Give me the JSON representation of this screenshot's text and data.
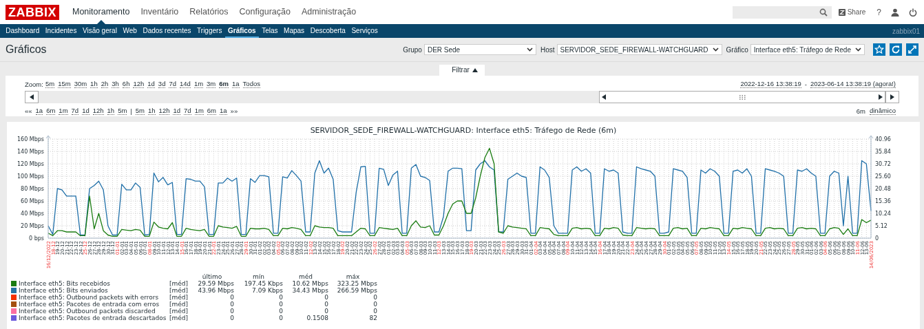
{
  "header": {
    "logo": "ZABBIX",
    "menu": [
      {
        "label": "Monitoramento",
        "selected": true
      },
      {
        "label": "Inventário",
        "selected": false
      },
      {
        "label": "Relatórios",
        "selected": false
      },
      {
        "label": "Configuração",
        "selected": false
      },
      {
        "label": "Administração",
        "selected": false
      }
    ],
    "share": "Share",
    "help": "?"
  },
  "submenu": {
    "items": [
      {
        "label": "Dashboard",
        "selected": false
      },
      {
        "label": "Incidentes",
        "selected": false
      },
      {
        "label": "Visão geral",
        "selected": false
      },
      {
        "label": "Web",
        "selected": false
      },
      {
        "label": "Dados recentes",
        "selected": false
      },
      {
        "label": "Triggers",
        "selected": false
      },
      {
        "label": "Gráficos",
        "selected": true
      },
      {
        "label": "Telas",
        "selected": false
      },
      {
        "label": "Mapas",
        "selected": false
      },
      {
        "label": "Descoberta",
        "selected": false
      },
      {
        "label": "Serviços",
        "selected": false
      }
    ],
    "server": "zabbix01"
  },
  "page": {
    "title": "Gráficos",
    "filters": [
      {
        "label": "Grupo",
        "value": "DER Sede"
      },
      {
        "label": "Host",
        "value": "SERVIDOR_SEDE_FIREWALL-WATCHGUARD"
      },
      {
        "label": "Gráfico",
        "value": "Interface eth5: Tráfego de Rede"
      }
    ]
  },
  "filter_tab": {
    "label": "Filtrar",
    "expanded": true
  },
  "time": {
    "zoom_label": "Zoom:",
    "zoom": [
      {
        "label": "5m",
        "selected": false
      },
      {
        "label": "15m",
        "selected": false
      },
      {
        "label": "30m",
        "selected": false
      },
      {
        "label": "1h",
        "selected": false
      },
      {
        "label": "2h",
        "selected": false
      },
      {
        "label": "3h",
        "selected": false
      },
      {
        "label": "6h",
        "selected": false
      },
      {
        "label": "12h",
        "selected": false
      },
      {
        "label": "1d",
        "selected": false
      },
      {
        "label": "3d",
        "selected": false
      },
      {
        "label": "7d",
        "selected": false
      },
      {
        "label": "14d",
        "selected": false
      },
      {
        "label": "1m",
        "selected": false
      },
      {
        "label": "3m",
        "selected": false
      },
      {
        "label": "6m",
        "selected": true
      },
      {
        "label": "1a",
        "selected": false
      },
      {
        "label": "Todos",
        "selected": false
      }
    ],
    "back_label": "««",
    "back": [
      "1a",
      "6m",
      "1m",
      "7d",
      "1d",
      "12h",
      "1h",
      "5m"
    ],
    "separator": "|",
    "forward": [
      "5m",
      "1h",
      "12h",
      "1d",
      "7d",
      "1m",
      "6m",
      "1a"
    ],
    "forward_label": "»»",
    "range_from": "2022-12-16 13:38:19",
    "range_separator": "-",
    "range_to": "2023-06-14 13:38:19 (agora!)",
    "period": "6m",
    "mode": "dinâmico"
  },
  "graph": {
    "title": "SERVIDOR_SEDE_FIREWALL-WATCHGUARD: Interface eth5: Tráfego de Rede (6m)",
    "chart_data": {
      "type": "line",
      "grid": true,
      "ylim": [
        0,
        160
      ],
      "y2lim": [
        0,
        40.96
      ],
      "yticks": [
        {
          "value": 0,
          "label": "0 bps"
        },
        {
          "value": 20,
          "label": "20 Mbps"
        },
        {
          "value": 40,
          "label": "40 Mbps"
        },
        {
          "value": 60,
          "label": "60 Mbps"
        },
        {
          "value": 80,
          "label": "80 Mbps"
        },
        {
          "value": 100,
          "label": "100 Mbps"
        },
        {
          "value": 120,
          "label": "120 Mbps"
        },
        {
          "value": 140,
          "label": "140 Mbps"
        },
        {
          "value": 160,
          "label": "160 Mbps"
        }
      ],
      "y2ticks": [
        {
          "value": 0,
          "label": "0"
        },
        {
          "value": 5.12,
          "label": "5.12"
        },
        {
          "value": 10.24,
          "label": "10.24"
        },
        {
          "value": 15.36,
          "label": "15.36"
        },
        {
          "value": 20.48,
          "label": "20.48"
        },
        {
          "value": 25.6,
          "label": "25.60"
        },
        {
          "value": 30.72,
          "label": "30.72"
        },
        {
          "value": 35.84,
          "label": "35.84"
        },
        {
          "value": 40.96,
          "label": "40.96"
        }
      ],
      "categories": [
        "16/12/2022",
        "18-12",
        "19-12",
        "20-12",
        "21-12",
        "22-12",
        "23-12",
        "24-12",
        "25-12",
        "26-12",
        "27-12",
        "28-12",
        "29-12",
        "30-12",
        "31-12",
        "01-01",
        "02-01",
        "03-01",
        "04-01",
        "05-01",
        "06-01",
        "07-01",
        "08-01",
        "09-01",
        "10-01",
        "11-01",
        "12-01",
        "13-01",
        "14-01",
        "15-01",
        "16-01",
        "17-01",
        "18-01",
        "19-01",
        "20-01",
        "21-01",
        "22-01",
        "23-01",
        "24-01",
        "25-01",
        "26-01",
        "27-01",
        "28-01",
        "29-01",
        "30-01",
        "31-01",
        "01-02",
        "02-02",
        "03-02",
        "04-02",
        "05-02",
        "06-02",
        "07-02",
        "08-02",
        "09-02",
        "10-02",
        "11-02",
        "12-02",
        "13-02",
        "14-02",
        "15-02",
        "16-02",
        "17-02",
        "18-02",
        "19-02",
        "20-02",
        "21-02",
        "22-02",
        "23-02",
        "24-02",
        "25-02",
        "26-02",
        "27-02",
        "28-02",
        "01-03",
        "02-03",
        "03-03",
        "04-03",
        "05-03",
        "06-03",
        "07-03",
        "08-03",
        "09-03",
        "10-03",
        "11-03",
        "12-03",
        "13-03",
        "14-03",
        "15-03",
        "16-03",
        "17-03",
        "18-03",
        "19-03",
        "20-03",
        "21-03",
        "22-03",
        "23-03",
        "24-03",
        "25-03",
        "26-03",
        "27-03",
        "28-03",
        "29-03",
        "30-03",
        "31-03",
        "01-04",
        "02-04",
        "03-04",
        "04-04",
        "05-04",
        "06-04",
        "07-04",
        "08-04",
        "09-04",
        "10-04",
        "11-04",
        "12-04",
        "13-04",
        "14-04",
        "15-04",
        "16-04",
        "17-04",
        "18-04",
        "19-04",
        "20-04",
        "21-04",
        "22-04",
        "23-04",
        "24-04",
        "25-04",
        "26-04",
        "27-04",
        "28-04",
        "29-04",
        "30-04",
        "01-05",
        "02-05",
        "03-05",
        "04-05",
        "05-05",
        "06-05",
        "07-05",
        "08-05",
        "09-05",
        "10-05",
        "11-05",
        "12-05",
        "13-05",
        "14-05",
        "15-05",
        "16-05",
        "17-05",
        "18-05",
        "19-05",
        "20-05",
        "21-05",
        "22-05",
        "23-05",
        "24-05",
        "25-05",
        "26-05",
        "27-05",
        "28-05",
        "29-05",
        "30-05",
        "31-05",
        "01-06",
        "02-06",
        "03-06",
        "04-06",
        "05-06",
        "06-06",
        "07-06",
        "08-06",
        "09-06",
        "10-06",
        "11-06",
        "12-06",
        "13-06",
        "14/06/2023"
      ],
      "series": [
        {
          "color": "#1f6fa8",
          "values": [
            20,
            6,
            80,
            78,
            68,
            68,
            68,
            5,
            5,
            80,
            85,
            92,
            78,
            20,
            5,
            5,
            87,
            78,
            78,
            89,
            82,
            5,
            6,
            105,
            91,
            98,
            86,
            90,
            6,
            6,
            96,
            95,
            92,
            92,
            83,
            6,
            6,
            89,
            89,
            97,
            92,
            97,
            6,
            6,
            96,
            90,
            101,
            101,
            99,
            8,
            8,
            99,
            97,
            109,
            101,
            92,
            10,
            10,
            105,
            125,
            105,
            113,
            95,
            12,
            10,
            10,
            10,
            74,
            115,
            116,
            8,
            8,
            113,
            111,
            85,
            102,
            108,
            8,
            8,
            113,
            119,
            100,
            98,
            93,
            10,
            10,
            35,
            108,
            113,
            113,
            112,
            12,
            12,
            110,
            120,
            125,
            115,
            110,
            10,
            10,
            95,
            100,
            105,
            100,
            98,
            8,
            8,
            115,
            110,
            98,
            20,
            8,
            8,
            8,
            110,
            115,
            108,
            112,
            105,
            8,
            8,
            112,
            108,
            110,
            105,
            10,
            8,
            8,
            115,
            112,
            110,
            108,
            100,
            8,
            8,
            10,
            112,
            110,
            108,
            98,
            8,
            8,
            110,
            105,
            112,
            108,
            100,
            8,
            8,
            108,
            110,
            105,
            112,
            100,
            8,
            8,
            112,
            110,
            108,
            105,
            100,
            8,
            8,
            110,
            108,
            112,
            105,
            100,
            8,
            8,
            100,
            108,
            105,
            20,
            100,
            8,
            8,
            125,
            120,
            44
          ]
        },
        {
          "color": "#1a7c11",
          "values": [
            8,
            4,
            12,
            12,
            10,
            10,
            10,
            4,
            4,
            68,
            15,
            40,
            12,
            5,
            3,
            3,
            14,
            13,
            12,
            14,
            13,
            3,
            3,
            26,
            18,
            16,
            15,
            25,
            3,
            3,
            16,
            14,
            13,
            12,
            14,
            3,
            3,
            20,
            18,
            17,
            16,
            19,
            3,
            3,
            16,
            15,
            15,
            16,
            14,
            4,
            4,
            16,
            15,
            17,
            16,
            14,
            4,
            4,
            20,
            18,
            17,
            17,
            16,
            4,
            4,
            4,
            4,
            10,
            16,
            15,
            4,
            4,
            17,
            16,
            15,
            14,
            16,
            4,
            4,
            20,
            28,
            18,
            17,
            20,
            5,
            5,
            20,
            40,
            55,
            60,
            60,
            40,
            40,
            65,
            100,
            130,
            145,
            120,
            10,
            8,
            20,
            18,
            17,
            16,
            15,
            4,
            4,
            17,
            16,
            15,
            6,
            4,
            4,
            4,
            16,
            17,
            15,
            16,
            15,
            4,
            4,
            16,
            15,
            17,
            16,
            5,
            4,
            4,
            17,
            16,
            15,
            16,
            15,
            4,
            4,
            4,
            16,
            17,
            15,
            16,
            4,
            4,
            16,
            15,
            17,
            16,
            15,
            4,
            4,
            16,
            15,
            17,
            16,
            15,
            4,
            4,
            16,
            17,
            15,
            16,
            15,
            4,
            4,
            16,
            17,
            15,
            16,
            15,
            4,
            4,
            15,
            17,
            16,
            6,
            15,
            4,
            4,
            30,
            25,
            29
          ]
        }
      ]
    },
    "x_label_highlight": [
      true,
      true,
      false,
      false,
      false,
      false,
      false,
      false,
      true,
      false,
      false,
      false,
      false,
      false,
      false,
      true,
      false,
      false,
      false,
      false,
      false,
      false,
      true,
      false,
      false,
      false,
      false,
      false,
      false,
      true,
      false,
      false,
      false,
      false,
      false,
      false,
      true,
      false,
      false,
      false,
      false,
      false,
      false,
      true,
      false,
      false,
      false,
      false,
      false,
      false,
      true,
      false,
      false,
      false,
      false,
      false,
      false,
      true,
      false,
      false,
      false,
      false,
      false,
      false,
      true,
      false,
      false,
      false,
      false,
      false,
      false,
      true,
      false,
      false,
      false,
      false,
      false,
      false,
      true,
      false,
      false,
      false,
      false,
      false,
      false,
      true,
      false,
      false,
      false,
      false,
      false,
      false,
      true,
      false,
      false,
      false,
      false,
      false,
      false,
      true,
      false,
      false,
      false,
      false,
      false,
      false,
      true,
      false,
      false,
      false,
      false,
      false,
      false,
      true,
      false,
      false,
      false,
      false,
      false,
      false,
      true,
      false,
      false,
      false,
      false,
      false,
      false,
      true,
      false,
      false,
      false,
      false,
      false,
      false,
      true,
      false,
      false,
      false,
      false,
      false,
      false,
      true,
      false,
      false,
      false,
      false,
      false,
      false,
      true,
      false,
      false,
      false,
      false,
      false,
      false,
      true,
      false,
      false,
      false,
      false,
      false,
      false,
      true,
      false,
      false,
      false,
      false,
      false,
      false,
      true,
      false,
      false,
      false,
      false,
      false,
      false,
      true,
      false,
      false,
      true
    ],
    "legend": {
      "columns": [
        "último",
        "mín",
        "méd",
        "máx"
      ],
      "rows": [
        {
          "name": "Interface eth5: Bits recebidos",
          "color": "#1a7c11",
          "func": "[méd]",
          "values": [
            "29.59 Mbps",
            "197.45 Kbps",
            "10.62 Mbps",
            "323.25 Mbps"
          ]
        },
        {
          "name": "Interface eth5: Bits enviados",
          "color": "#2774a4",
          "func": "[méd]",
          "values": [
            "43.96 Mbps",
            "7.09 Kbps",
            "34.43 Mbps",
            "266.59 Mbps"
          ]
        },
        {
          "name": "Interface eth5: Outbound packets with errors",
          "color": "#f63100",
          "func": "[méd]",
          "values": [
            "0",
            "0",
            "0",
            "0"
          ]
        },
        {
          "name": "Interface eth5: Pacotes de entrada com erros",
          "color": "#a54f10",
          "func": "[méd]",
          "values": [
            "0",
            "0",
            "0",
            "0"
          ]
        },
        {
          "name": "Interface eth5: Outbound packets discarded",
          "color": "#fc6ea3",
          "func": "[méd]",
          "values": [
            "0",
            "0",
            "0",
            "0"
          ]
        },
        {
          "name": "Interface eth5: Pacotes de entrada descartados",
          "color": "#6c59dc",
          "func": "[méd]",
          "values": [
            "0",
            "0",
            "0.1508",
            "82"
          ]
        }
      ]
    }
  }
}
